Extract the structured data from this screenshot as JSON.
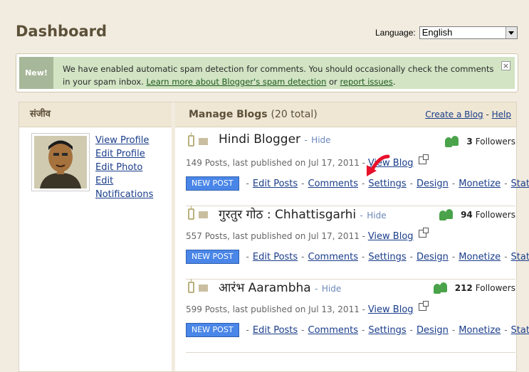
{
  "header": {
    "title": "Dashboard",
    "language_label": "Language:",
    "language_value": "English"
  },
  "notice": {
    "badge": "New!",
    "text": "We have enabled automatic spam detection for comments. You should occasionally check the comments in your spam inbox.",
    "link1": "Learn more about Blogger's spam detection",
    "or": "or",
    "link2": "report issues",
    "period": ".",
    "close": "×"
  },
  "profile": {
    "name": "संजीव",
    "links": [
      "View Profile",
      "Edit Profile",
      "Edit Photo",
      "Edit Notifications"
    ]
  },
  "manage": {
    "title": "Manage Blogs",
    "count": "(20 total)",
    "create_link": "Create a Blog",
    "separator": " - ",
    "help_link": "Help"
  },
  "blog_common": {
    "hide": "Hide",
    "view_blog": "View Blog",
    "new_post": "NEW POST",
    "edit_posts": "Edit Posts",
    "comments": "Comments",
    "settings": "Settings",
    "design": "Design",
    "monetize": "Monetize",
    "stats": "Stats",
    "dash": "-",
    "followers_word": "Followers"
  },
  "blogs": [
    {
      "title": "Hindi Blogger",
      "followers": "3",
      "meta": "149 Posts, last published on Jul 17, 2011 -"
    },
    {
      "title": "गुरतुर गोठ : Chhattisgarhi",
      "followers": "94",
      "meta": "557 Posts, last published on Jul 17, 2011 -"
    },
    {
      "title": "आरंभ Aarambha",
      "followers": "212",
      "meta": "599 Posts, last published on Jul 13, 2011 -"
    }
  ],
  "colors": {
    "accent_button": "#4a86e8",
    "notice_bg": "#d2e4c4",
    "followers_icon": "#4aa34a",
    "annotation_arrow": "#e8102a"
  }
}
